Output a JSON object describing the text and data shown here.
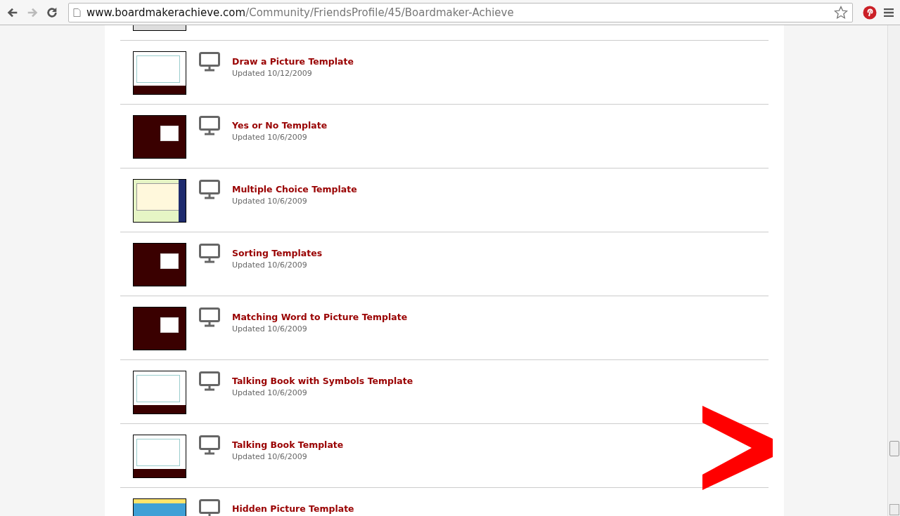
{
  "browser": {
    "url_host": "www.boardmakerachieve.com",
    "url_path": "/Community/FriendsProfile/45/Boardmaker-Achieve"
  },
  "items": [
    {
      "title": "Draw a Picture Template",
      "updated": "Updated 10/12/2009",
      "kind": "light"
    },
    {
      "title": "Yes or No Template",
      "updated": "Updated 10/6/2009",
      "kind": "dark"
    },
    {
      "title": "Multiple Choice Template",
      "updated": "Updated 10/6/2009",
      "kind": "grid"
    },
    {
      "title": "Sorting Templates",
      "updated": "Updated 10/6/2009",
      "kind": "dark"
    },
    {
      "title": "Matching Word to Picture Template",
      "updated": "Updated 10/6/2009",
      "kind": "dark"
    },
    {
      "title": "Talking Book with Symbols Template",
      "updated": "Updated 10/6/2009",
      "kind": "light"
    },
    {
      "title": "Talking Book Template",
      "updated": "Updated 10/6/2009",
      "kind": "light"
    },
    {
      "title": "Hidden Picture Template",
      "kind": "blue"
    }
  ]
}
